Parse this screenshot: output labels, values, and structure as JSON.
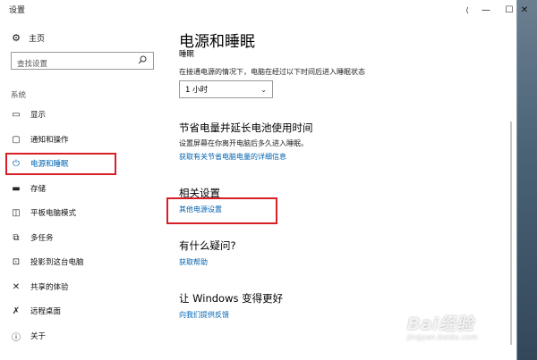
{
  "window": {
    "title": "设置",
    "controls": {
      "back": "⟨",
      "minimize": "—",
      "maximize": "☐",
      "close": "✕"
    }
  },
  "sidebar": {
    "home": {
      "label": "主页",
      "icon": "gear-icon"
    },
    "search": {
      "placeholder": "查找设置",
      "icon": "search-icon"
    },
    "section_label": "系统",
    "items": [
      {
        "label": "显示",
        "icon": "display-icon"
      },
      {
        "label": "通知和操作",
        "icon": "notifications-icon"
      },
      {
        "label": "电源和睡眠",
        "icon": "power-icon",
        "active": true
      },
      {
        "label": "存储",
        "icon": "storage-icon"
      },
      {
        "label": "平板电脑模式",
        "icon": "tablet-mode-icon"
      },
      {
        "label": "多任务",
        "icon": "multitasking-icon"
      },
      {
        "label": "投影到这台电脑",
        "icon": "projection-icon"
      },
      {
        "label": "共享的体验",
        "icon": "shared-experience-icon"
      },
      {
        "label": "远程桌面",
        "icon": "remote-desktop-icon"
      },
      {
        "label": "关于",
        "icon": "about-icon"
      }
    ]
  },
  "main": {
    "title": "电源和睡眠",
    "sleep": {
      "heading": "睡眠",
      "description": "在接通电源的情况下，电脑在经过以下时间后进入睡眠状态",
      "selected_value": "1 小时"
    },
    "battery": {
      "heading": "节省电量并延长电池使用时间",
      "description": "设置屏幕在你离开电脑后多久进入睡眠。",
      "link": "获取有关节省电脑电量的详细信息"
    },
    "related": {
      "heading": "相关设置",
      "link": "其他电源设置"
    },
    "questions": {
      "heading": "有什么疑问?",
      "link": "获取帮助"
    },
    "improve": {
      "heading": "让 Windows 变得更好",
      "link": "向我们提供反馈"
    }
  },
  "annotation_color": "#d81f26",
  "accent_color": "#0063b1",
  "watermark": {
    "logo": "Bai经验",
    "url": "jingyan.baidu.com"
  }
}
